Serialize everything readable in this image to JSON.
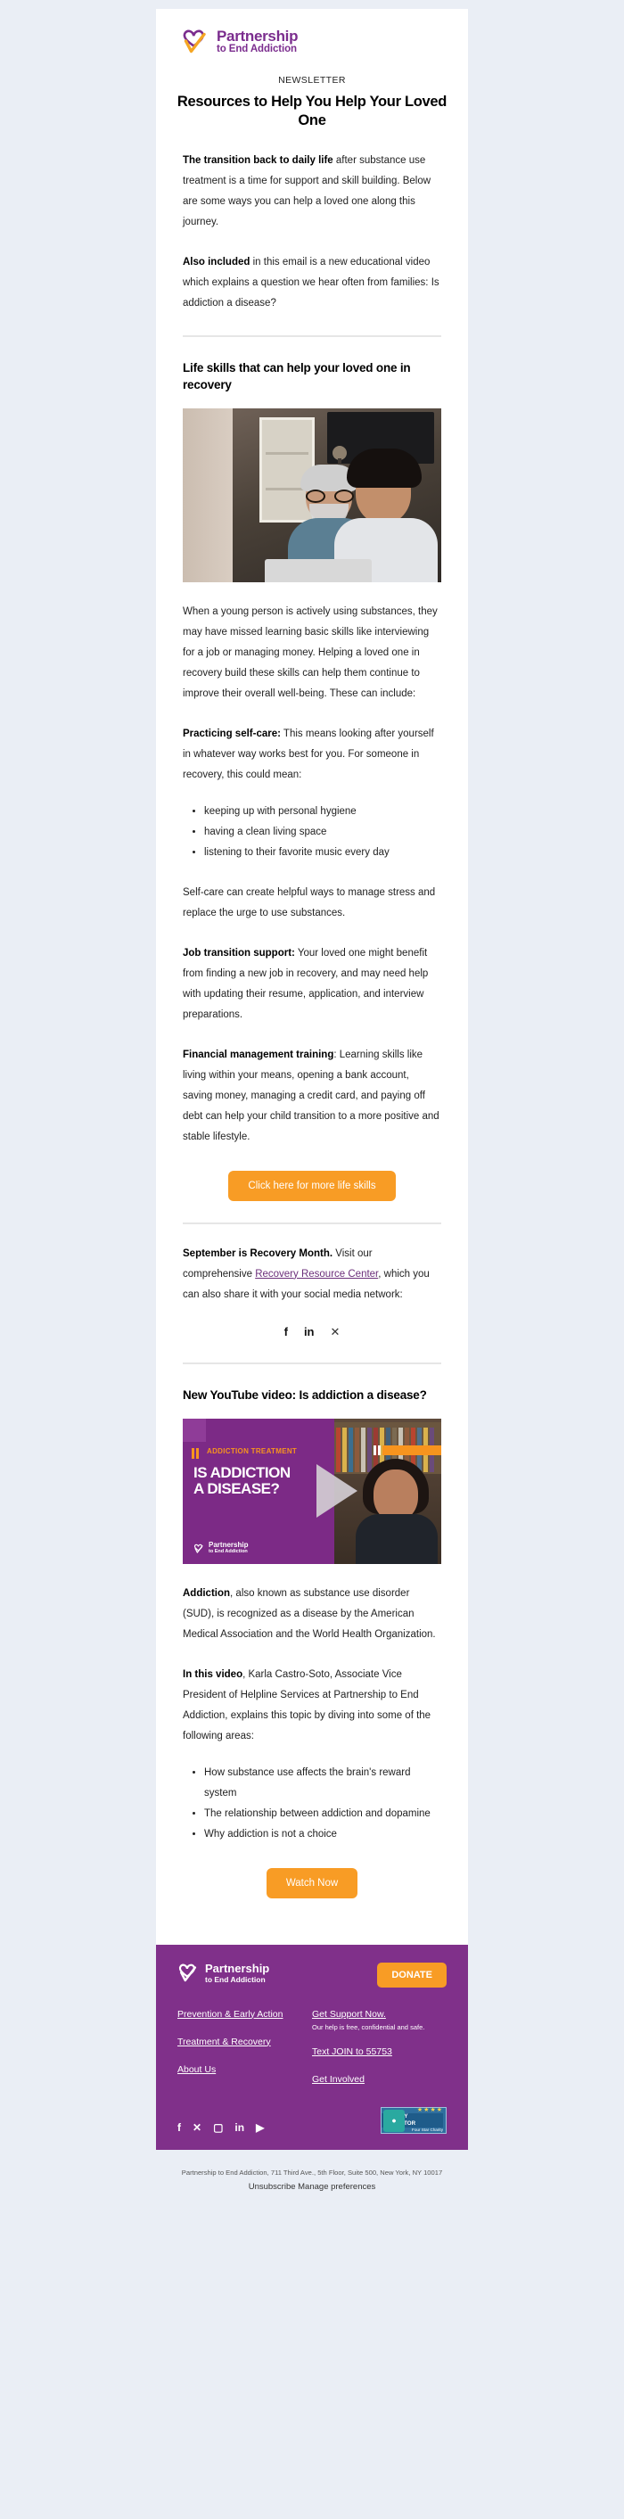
{
  "brand": {
    "name_line1": "Partnership",
    "name_line2": "to End Addiction",
    "purple": "#7b2d8e",
    "orange": "#f89c25",
    "footer_purple": "#80308a"
  },
  "header": {
    "kicker": "NEWSLETTER",
    "headline": "Resources to Help You Help Your Loved One"
  },
  "intro": {
    "p1_bold": "The transition back to daily life",
    "p1_rest": " after substance use treatment is a time for support and skill building. Below are some ways you can help a loved one along this journey.",
    "p2_bold": "Also included",
    "p2_rest": " in this email is a new educational video which explains a question we hear often from families: Is addiction a disease?"
  },
  "life_skills": {
    "section_title": "Life skills that can help your loved one in recovery",
    "photo_alt": "older man and young man smiling at a laptop",
    "p1": "When a young person is actively using substances, they may have missed learning basic skills like interviewing for a job or managing money. Helping a loved one in recovery build these skills can help them continue to improve their overall well-being. These can include:",
    "self_care_bold": "Practicing self-care:",
    "self_care_rest": " This means looking after yourself in whatever way works best for you. For someone in recovery, this could mean:",
    "bullets": [
      "keeping up with personal hygiene",
      "having a clean living space",
      "listening to their favorite music every day"
    ],
    "p2": "Self-care can create helpful ways to manage stress and replace the urge to use substances.",
    "job_bold": "Job transition support:",
    "job_rest": " Your loved one might benefit from finding a new job in recovery, and may need help with updating their resume, application, and interview preparations.",
    "finance_bold": "Financial management training",
    "finance_rest": ": Learning skills like living within your means, opening a bank account, saving money, managing a credit card, and paying off debt can help your child transition to a more positive and stable lifestyle.",
    "cta_label": "Click here for more life skills"
  },
  "recovery_month": {
    "bold": "September is Recovery Month.",
    "text_before_link": " Visit our comprehensive ",
    "link_label": "Recovery Resource Center",
    "text_after_link": ", which you can also share it with your social media network:",
    "share_icons": [
      {
        "name": "facebook-icon",
        "glyph": "f"
      },
      {
        "name": "linkedin-icon",
        "glyph": "in"
      },
      {
        "name": "x-twitter-icon",
        "glyph": "✕"
      }
    ]
  },
  "video_section": {
    "section_title": "New YouTube video: Is addiction a disease?",
    "thumb_eyebrow": "ADDICTION TREATMENT",
    "thumb_title_line1": "IS ADDICTION",
    "thumb_title_line2": "A DISEASE?",
    "thumb_logo_line1": "Partnership",
    "thumb_logo_line2": "to End Addiction",
    "p1_bold": "Addiction",
    "p1_rest": ", also known as substance use disorder (SUD), is recognized as a disease by the American Medical Association and the World Health Organization.",
    "p2_bold": "In this video",
    "p2_rest": ", Karla Castro-Soto, Associate Vice President of Helpline Services at Partnership to End Addiction, explains this topic by diving into some of the following areas:",
    "bullets": [
      "How substance use affects the brain's reward system",
      "The relationship between addiction and dopamine",
      "Why addiction is not a choice"
    ],
    "cta_label": "Watch Now"
  },
  "footer": {
    "logo_line1": "Partnership",
    "logo_line2": "to End Addiction",
    "donate_label": "DONATE",
    "left_links": [
      "Prevention & Early Action",
      "Treatment & Recovery",
      "About Us"
    ],
    "right_links": [
      "Get Support Now.",
      "Text JOIN to 55753",
      "Get Involved"
    ],
    "support_subtext": "Our help is free, confidential and safe.",
    "social": [
      {
        "name": "facebook-icon",
        "glyph": "f"
      },
      {
        "name": "x-twitter-icon",
        "glyph": "✕"
      },
      {
        "name": "instagram-icon",
        "glyph": "▢"
      },
      {
        "name": "linkedin-icon",
        "glyph": "in"
      },
      {
        "name": "youtube-icon",
        "glyph": "▶"
      }
    ],
    "charity_badge": {
      "stars": "★★★★",
      "title": "CHARITY NAVIGATOR",
      "subtitle": "Four Star Charity"
    }
  },
  "legal": {
    "address": "Partnership to End Addiction, 711 Third Ave., 5th Floor, Suite 500, New York, NY 10017",
    "unsubscribe": "Unsubscribe Manage preferences"
  }
}
